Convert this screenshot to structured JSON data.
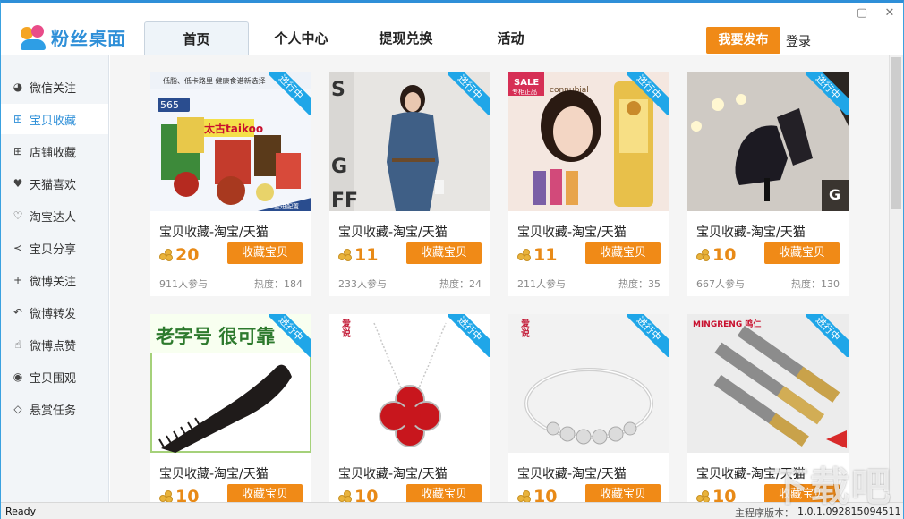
{
  "app": {
    "logo_text": "粉丝桌面"
  },
  "nav": {
    "tabs": [
      {
        "label": "首页",
        "active": true
      },
      {
        "label": "个人中心",
        "active": false
      },
      {
        "label": "提现兑换",
        "active": false
      },
      {
        "label": "活动",
        "active": false
      }
    ]
  },
  "header": {
    "publish_label": "我要发布",
    "login_label": "登录"
  },
  "window_controls": {
    "minimize": "—",
    "restore": "▢",
    "close": "✕"
  },
  "sidebar": {
    "items": [
      {
        "label": "微信关注",
        "icon": "wechat-icon",
        "glyph": "◕"
      },
      {
        "label": "宝贝收藏",
        "icon": "plus-square-icon",
        "glyph": "⊞",
        "active": true
      },
      {
        "label": "店铺收藏",
        "icon": "plus-box-icon",
        "glyph": "⊞"
      },
      {
        "label": "天猫喜欢",
        "icon": "heart-icon",
        "glyph": "♥"
      },
      {
        "label": "淘宝达人",
        "icon": "heart-outline-icon",
        "glyph": "♡"
      },
      {
        "label": "宝贝分享",
        "icon": "share-icon",
        "glyph": "≺"
      },
      {
        "label": "微博关注",
        "icon": "plus-icon",
        "glyph": "+"
      },
      {
        "label": "微博转发",
        "icon": "reply-icon",
        "glyph": "↶"
      },
      {
        "label": "微博点赞",
        "icon": "thumbs-up-icon",
        "glyph": "☝"
      },
      {
        "label": "宝贝围观",
        "icon": "eye-icon",
        "glyph": "◉"
      },
      {
        "label": "悬赏任务",
        "icon": "diamond-icon",
        "glyph": "◇"
      }
    ]
  },
  "cards": [
    {
      "title": "宝贝收藏-淘宝/天猫",
      "coins": "20",
      "button": "收藏宝贝",
      "participants": "911人参与",
      "heat": "热度：184",
      "ribbon": "进行中",
      "image": "food-gift-box",
      "img_text": "低脂、低卡路里  健康食谱新选择",
      "price_tag": "565",
      "brand": "太古taikoo",
      "footer_text": "全进配置"
    },
    {
      "title": "宝贝收藏-淘宝/天猫",
      "coins": "11",
      "button": "收藏宝贝",
      "participants": "233人参与",
      "heat": "热度：24",
      "ribbon": "进行中",
      "image": "denim-dress"
    },
    {
      "title": "宝贝收藏-淘宝/天猫",
      "coins": "11",
      "button": "收藏宝贝",
      "participants": "211人参与",
      "heat": "热度：35",
      "ribbon": "进行中",
      "image": "perfume",
      "brand": "connubial",
      "sale_text": "SALE",
      "sale_sub": "专柜正品"
    },
    {
      "title": "宝贝收藏-淘宝/天猫",
      "coins": "10",
      "button": "收藏宝贝",
      "participants": "667人参与",
      "heat": "热度：130",
      "ribbon": "进行中",
      "image": "ankle-boots"
    },
    {
      "title": "宝贝收藏-淘宝/天猫",
      "coins": "10",
      "button": "收藏宝贝",
      "participants": "",
      "heat": "",
      "ribbon": "进行中",
      "image": "horn-comb",
      "img_text": "老字号  很可靠"
    },
    {
      "title": "宝贝收藏-淘宝/天猫",
      "coins": "10",
      "button": "收藏宝贝",
      "participants": "",
      "heat": "",
      "ribbon": "进行中",
      "image": "clover-necklace",
      "seal_text": "爱\n说"
    },
    {
      "title": "宝贝收藏-淘宝/天猫",
      "coins": "10",
      "button": "收藏宝贝",
      "participants": "",
      "heat": "",
      "ribbon": "进行中",
      "image": "silver-bracelet",
      "seal_text": "爱\n说"
    },
    {
      "title": "宝贝收藏-淘宝/天猫",
      "coins": "10",
      "button": "收藏宝贝",
      "participants": "",
      "heat": "",
      "ribbon": "进行中",
      "image": "tap-drills",
      "brand": "MINGRENG 鸣仁"
    }
  ],
  "status": {
    "ready": "Ready",
    "version_label": "主程序版本：",
    "version": "1.0.1.092815094511"
  },
  "watermark": "下载吧"
}
